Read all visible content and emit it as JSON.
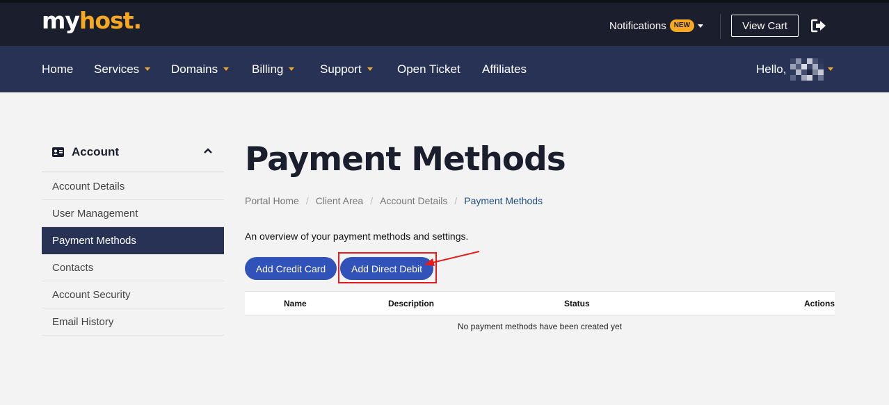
{
  "brand": {
    "logo_primary": "my",
    "logo_accent": "host.",
    "accent_color": "#f6a823"
  },
  "header": {
    "notifications_label": "Notifications",
    "notifications_badge": "NEW",
    "view_cart_label": "View Cart",
    "logout_icon": "sign-out-icon"
  },
  "nav": {
    "items": [
      {
        "label": "Home",
        "dropdown": false
      },
      {
        "label": "Services",
        "dropdown": true
      },
      {
        "label": "Domains",
        "dropdown": true
      },
      {
        "label": "Billing",
        "dropdown": true
      },
      {
        "label": "Support",
        "dropdown": true
      },
      {
        "label": "Open Ticket",
        "dropdown": false
      },
      {
        "label": "Affiliates",
        "dropdown": false
      }
    ],
    "greeting": "Hello,"
  },
  "sidebar": {
    "title": "Account",
    "icon": "id-card-icon",
    "items": [
      {
        "label": "Account Details"
      },
      {
        "label": "User Management"
      },
      {
        "label": "Payment Methods",
        "active": true
      },
      {
        "label": "Contacts"
      },
      {
        "label": "Account Security"
      },
      {
        "label": "Email History"
      }
    ]
  },
  "main": {
    "title": "Payment Methods",
    "breadcrumb": [
      "Portal Home",
      "Client Area",
      "Account Details",
      "Payment Methods"
    ],
    "intro": "An overview of your payment methods and settings.",
    "buttons": {
      "add_credit_card": "Add Credit Card",
      "add_direct_debit": "Add Direct Debit"
    },
    "table": {
      "columns": [
        "Name",
        "Description",
        "Status",
        "Actions"
      ],
      "empty_message": "No payment methods have been created yet"
    }
  },
  "colors": {
    "header": "#1b1e2c",
    "nav": "#283255",
    "button": "#3152b9",
    "annotation": "#e8191b"
  }
}
